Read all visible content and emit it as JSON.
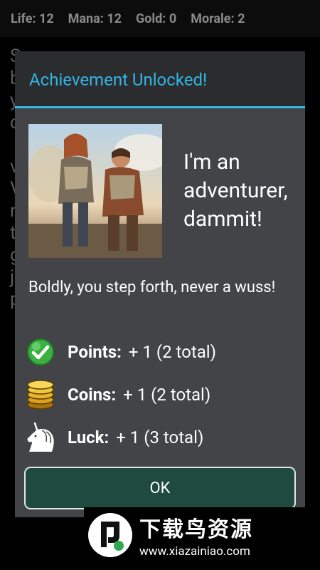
{
  "status": {
    "life": "Life: 12",
    "mana": "Mana: 12",
    "gold": "Gold: 0",
    "morale": "Morale: 2"
  },
  "dialog": {
    "title": "Achievement Unlocked!",
    "heading": "I'm an adventurer, dammit!",
    "message": "Boldly, you step forth, never a wuss!",
    "ok_label": "OK",
    "accent_color": "#33b5e5"
  },
  "rewards": [
    {
      "icon": "check-icon",
      "label": "Points:",
      "amount": "+ 1 (2 total)"
    },
    {
      "icon": "coins-icon",
      "label": "Coins:",
      "amount": "+ 1 (2 total)"
    },
    {
      "icon": "unicorn-icon",
      "label": "Luck:",
      "amount": "+ 1 (3 total)"
    }
  ],
  "watermark": {
    "title": "下载鸟资源",
    "url": "www.xiazainiao.com"
  }
}
